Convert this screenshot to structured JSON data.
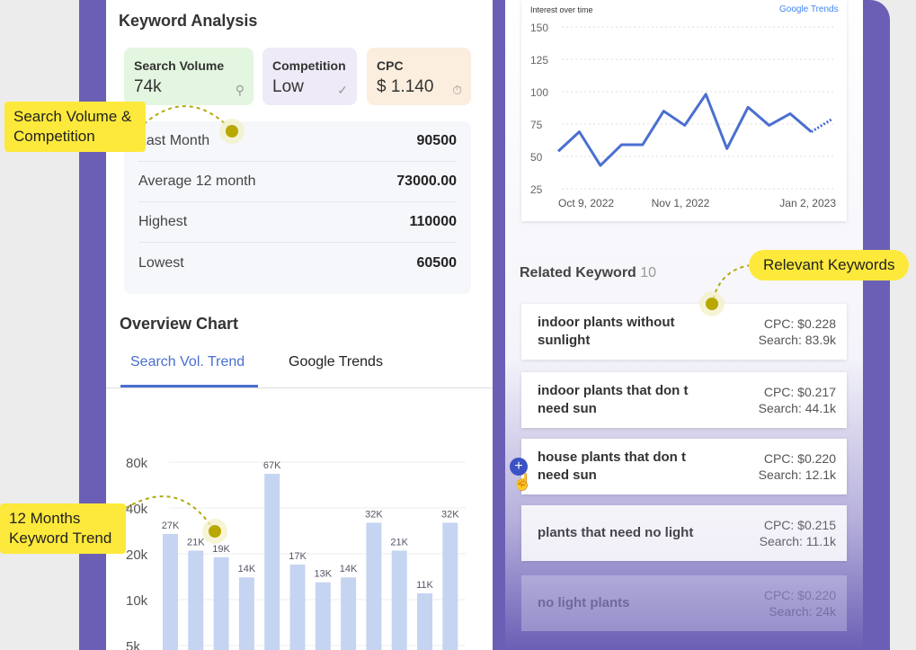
{
  "keyword_analysis": {
    "title": "Keyword Analysis",
    "metrics": [
      {
        "label": "Search Volume",
        "value": "74k",
        "icon": "search-icon",
        "color": "#e3f6df"
      },
      {
        "label": "Competition",
        "value": "Low",
        "icon": "flex-arm-icon",
        "color": "#eeeaf8"
      },
      {
        "label": "CPC",
        "value": "$ 1.140",
        "icon": "dollar-coin-icon",
        "color": "#fbeede"
      }
    ],
    "stats": [
      {
        "label": "Last Month",
        "value": "90500"
      },
      {
        "label": "Average 12 month",
        "value": "73000.00"
      },
      {
        "label": "Highest",
        "value": "110000"
      },
      {
        "label": "Lowest",
        "value": "60500"
      }
    ]
  },
  "overview": {
    "title": "Overview Chart",
    "tabs": [
      {
        "label": "Search Vol. Trend",
        "active": true
      },
      {
        "label": "Google Trends",
        "active": false
      }
    ],
    "accent": "#4a6fd0"
  },
  "callouts": [
    "Search Volume & Competition",
    "Relevant Keywords",
    "12 Months Keyword Trend"
  ],
  "chart_data": [
    {
      "type": "bar",
      "yscale": "log",
      "y_ticks": [
        "80k",
        "40k",
        "20k",
        "10k",
        "5k"
      ],
      "ylim": [
        5000,
        80000
      ],
      "values": [
        27000,
        21000,
        19000,
        14000,
        67000,
        17000,
        13000,
        14000,
        32000,
        21000,
        11000,
        32000
      ],
      "labels": [
        "27K",
        "21K",
        "19K",
        "14K",
        "67K",
        "17K",
        "13K",
        "14K",
        "32K",
        "21K",
        "11K",
        "32K"
      ],
      "grid": true,
      "bar_color": "#c5d4f1"
    },
    {
      "type": "line",
      "title": "Interest over time",
      "source": "Google Trends",
      "y_ticks": [
        150,
        125,
        100,
        75,
        50,
        25
      ],
      "ylim": [
        25,
        150
      ],
      "x_ticks": [
        "Oct 9, 2022",
        "Nov 1, 2022",
        "Jan 2, 2023"
      ],
      "values": [
        54,
        69,
        43,
        59,
        59,
        85,
        74,
        98,
        56,
        88,
        74,
        83,
        69,
        79
      ],
      "partial_last": true,
      "grid": true,
      "line_color": "#4a6fd0"
    }
  ],
  "related": {
    "title": "Related Keyword",
    "count": "10",
    "items": [
      {
        "kw": "indoor plants without sunlight",
        "cpc": "CPC: $0.228",
        "search": "Search: 83.9k"
      },
      {
        "kw": "indoor plants that don t need sun",
        "cpc": "CPC: $0.217",
        "search": "Search: 44.1k"
      },
      {
        "kw": "house plants that don t need sun",
        "cpc": "CPC: $0.220",
        "search": "Search: 12.1k"
      },
      {
        "kw": "plants that need no light",
        "cpc": "CPC: $0.215",
        "search": "Search: 11.1k"
      },
      {
        "kw": "no light plants",
        "cpc": "CPC: $0.220",
        "search": "Search: 24k"
      }
    ]
  }
}
